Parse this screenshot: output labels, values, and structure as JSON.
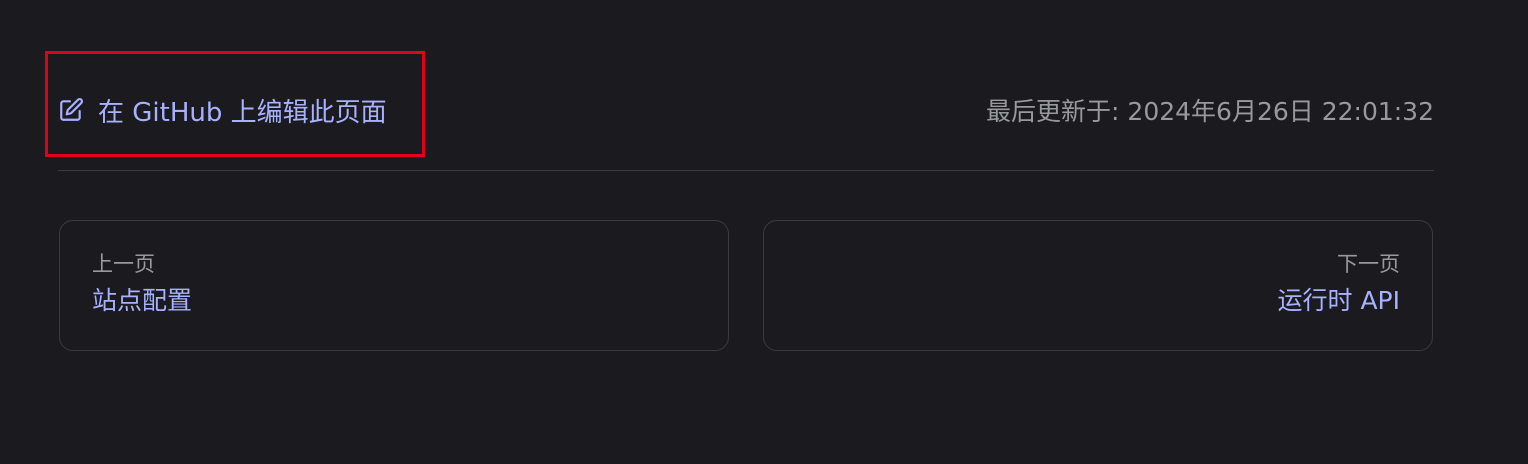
{
  "edit_info": {
    "edit_link_label": "在 GitHub 上编辑此页面",
    "last_updated_label": "最后更新于",
    "last_updated_separator": ": ",
    "last_updated_value": "2024年6月26日 22:01:32",
    "edit_icon": "edit-icon"
  },
  "pager": {
    "prev": {
      "desc": "上一页",
      "title": "站点配置"
    },
    "next": {
      "desc": "下一页",
      "title": "运行时 API"
    }
  },
  "colors": {
    "background": "#1b1b1f",
    "link": "#a8b1ff",
    "muted_text": "#98989f",
    "border": "#3a3a40",
    "highlight_box": "#e0001b"
  }
}
